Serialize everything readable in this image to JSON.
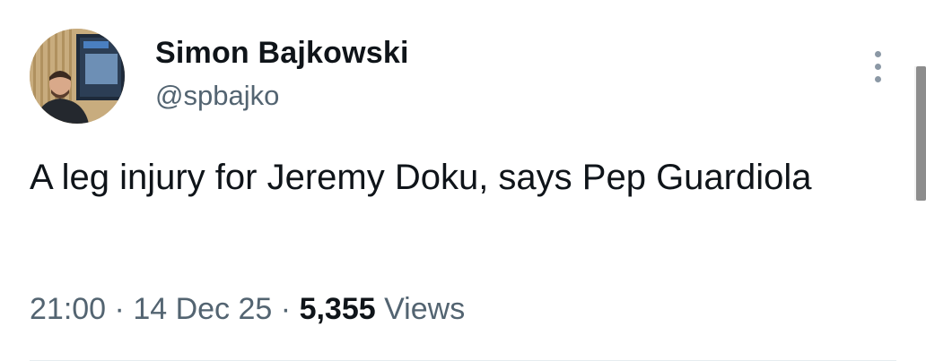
{
  "author": {
    "display_name": "Simon Bajkowski",
    "handle": "@spbajko",
    "avatar_icon": "profile-photo"
  },
  "tweet": {
    "text": "A leg injury for Jeremy Doku, says Pep Guardiola",
    "time": "21:00",
    "date": "14 Dec 25",
    "separator": "·",
    "views_count": "5,355",
    "views_label": "Views"
  },
  "menu": {
    "icon": "vertical-ellipsis-icon"
  },
  "colors": {
    "text_primary": "#0f1419",
    "text_secondary": "#536471",
    "divider": "#e6ecf0"
  }
}
